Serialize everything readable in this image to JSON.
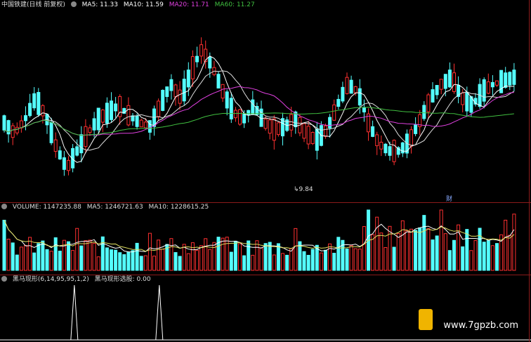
{
  "title": "中国铁建(日线 前复权)",
  "ma": [
    {
      "label": "MA5: 11.33",
      "color": "#ffffff"
    },
    {
      "label": "MA10: 11.59",
      "color": "#ffffff"
    },
    {
      "label": "MA20: 11.71",
      "color": "#e040e0"
    },
    {
      "label": "MA60: 11.27",
      "color": "#40c040"
    }
  ],
  "low_marker": "9.84",
  "finance_marker": "财",
  "volume": {
    "label": "VOLUME: 1147235.88",
    "ma5": "MA5: 1246721.63",
    "ma10": "MA10: 1228615.25"
  },
  "indicator": {
    "label": "黑马现形(6,14,95,95,1,2)",
    "value": "黑马现形选股: 0.00"
  },
  "watermark": "www.7gpzb.com",
  "colors": {
    "up": "#ff3030",
    "down": "#54ffff",
    "border": "#8b1a1a"
  },
  "indicator_spikes": [
    0.14,
    0.3
  ]
}
